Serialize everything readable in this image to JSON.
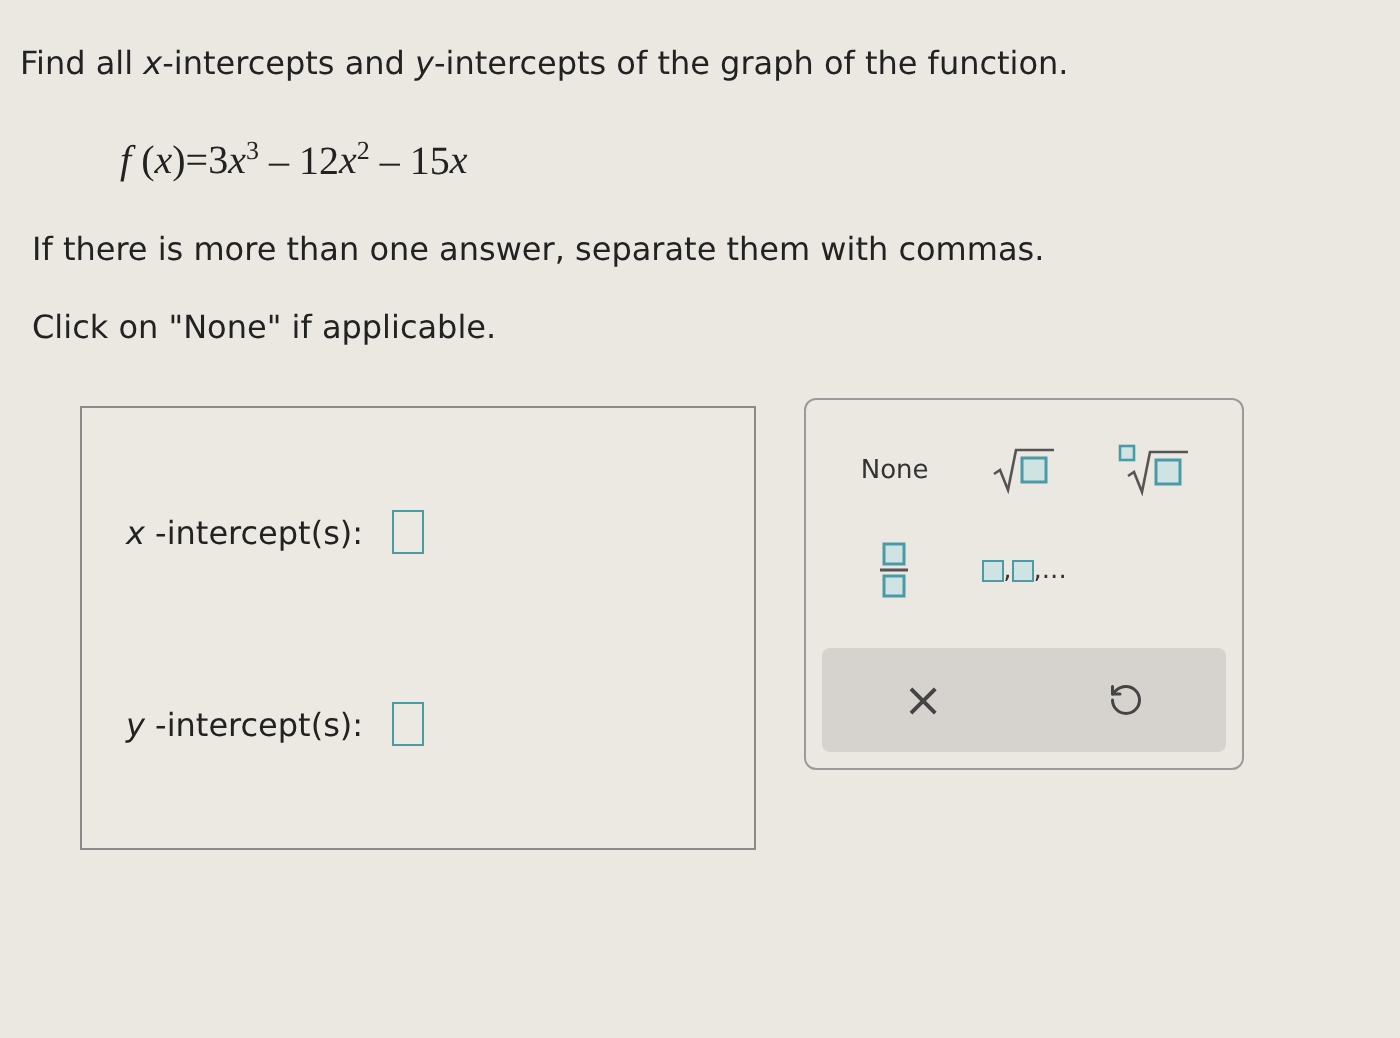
{
  "question": {
    "prompt": "Find all *x*-intercepts and *y*-intercepts of the graph of the function.",
    "equation": [
      {
        "text": "f",
        "italic": true
      },
      {
        "text": " (",
        "italic": false
      },
      {
        "text": "x",
        "italic": true
      },
      {
        "text": ")=3",
        "italic": false
      },
      {
        "text": "x",
        "italic": true
      },
      {
        "text": "$^{3}$ – 12",
        "italic": false
      },
      {
        "text": "x",
        "italic": true
      },
      {
        "text": "$^{2}$ – 15",
        "italic": false
      },
      {
        "text": "x",
        "italic": true
      }
    ],
    "instructions": [
      "If there is more than one answer, separate them with commas.",
      "Click on \"None\" if applicable."
    ]
  },
  "answers": [
    {
      "label": "*x* -intercept(s):"
    },
    {
      "label": "*y* -intercept(s):"
    }
  ],
  "keypad": {
    "keys": [
      {
        "kind": "text",
        "label": "None"
      },
      {
        "kind": "sqrt"
      },
      {
        "kind": "nthroot"
      },
      {
        "kind": "fraction"
      },
      {
        "kind": "list",
        "separator": ",",
        "tail": ",..."
      }
    ],
    "actions": [
      {
        "kind": "clear",
        "label": "×"
      },
      {
        "kind": "undo"
      }
    ]
  }
}
